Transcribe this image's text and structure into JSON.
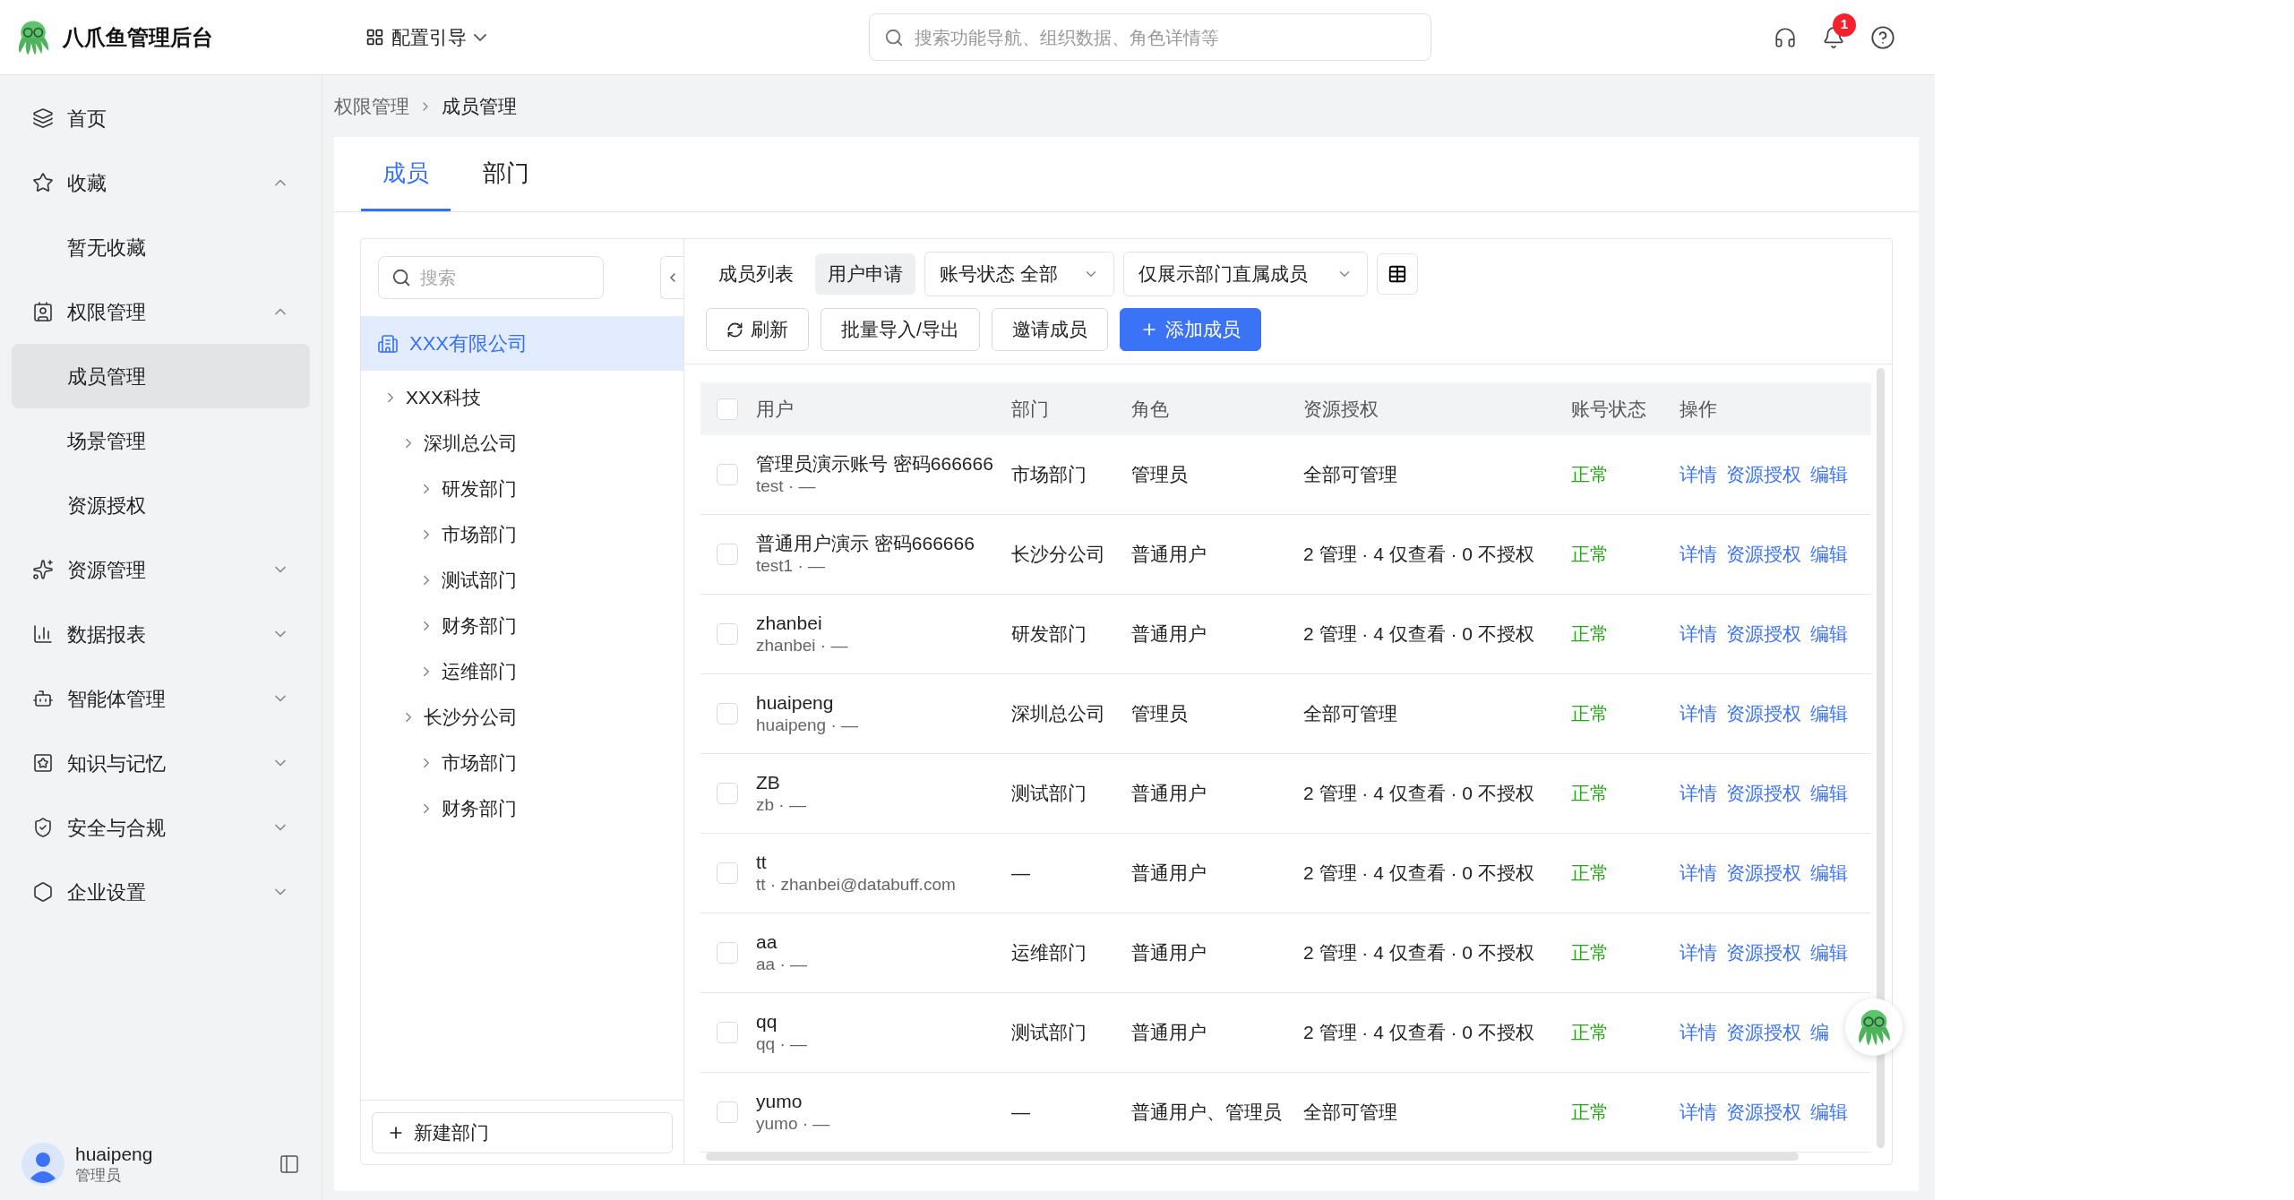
{
  "app": {
    "title": "八爪鱼管理后台"
  },
  "header": {
    "guide": "配置引导",
    "search_placeholder": "搜索功能导航、组织数据、角色详情等",
    "notification_count": "1"
  },
  "sidebar": {
    "items": [
      {
        "label": "首页",
        "kind": "link",
        "selected": false
      },
      {
        "label": "收藏",
        "kind": "group",
        "selected": false,
        "expanded": true,
        "children": [
          {
            "label": "暂无收藏",
            "selected": false
          }
        ]
      },
      {
        "label": "权限管理",
        "kind": "group",
        "selected": false,
        "expanded": true,
        "children": [
          {
            "label": "成员管理",
            "selected": true
          },
          {
            "label": "场景管理",
            "selected": false
          },
          {
            "label": "资源授权",
            "selected": false
          }
        ]
      },
      {
        "label": "资源管理",
        "kind": "group",
        "selected": false,
        "expanded": false
      },
      {
        "label": "数据报表",
        "kind": "group",
        "selected": false,
        "expanded": false
      },
      {
        "label": "智能体管理",
        "kind": "group",
        "selected": false,
        "expanded": false
      },
      {
        "label": "知识与记忆",
        "kind": "group",
        "selected": false,
        "expanded": false
      },
      {
        "label": "安全与合规",
        "kind": "group",
        "selected": false,
        "expanded": false
      },
      {
        "label": "企业设置",
        "kind": "group",
        "selected": false,
        "expanded": false
      }
    ],
    "user": {
      "name": "huaipeng",
      "role": "管理员"
    }
  },
  "breadcrumb": [
    "权限管理",
    "成员管理"
  ],
  "tabs": [
    {
      "label": "成员",
      "selected": true
    },
    {
      "label": "部门",
      "selected": false
    }
  ],
  "tree": {
    "search_placeholder": "搜索",
    "root": {
      "label": "XXX有限公司",
      "selected": true
    },
    "children": [
      {
        "label": "XXX科技",
        "children": [
          {
            "label": "深圳总公司",
            "children": [
              {
                "label": "研发部门"
              },
              {
                "label": "市场部门"
              },
              {
                "label": "测试部门"
              },
              {
                "label": "财务部门"
              },
              {
                "label": "运维部门"
              }
            ]
          },
          {
            "label": "长沙分公司",
            "children": [
              {
                "label": "市场部门"
              },
              {
                "label": "财务部门"
              }
            ]
          }
        ]
      }
    ],
    "new_button": "新建部门"
  },
  "toolbar": {
    "views": [
      {
        "label": "成员列表",
        "selected": false
      },
      {
        "label": "用户申请",
        "selected": true
      }
    ],
    "filters": [
      "账号状态 全部",
      "仅展示部门直属成员"
    ],
    "buttons": [
      {
        "label": "刷新",
        "kind": "refresh"
      },
      {
        "label": "批量导入/导出",
        "kind": "plain"
      },
      {
        "label": "邀请成员",
        "kind": "plain"
      },
      {
        "label": "添加成员",
        "kind": "primary"
      }
    ]
  },
  "table": {
    "columns": [
      "用户",
      "部门",
      "角色",
      "资源授权",
      "账号状态",
      "操作"
    ],
    "header_checked": false,
    "rows": [
      {
        "checked": false,
        "name": "管理员演示账号 密码666666",
        "sub": "test · —",
        "dept": "市场部门",
        "role": "管理员",
        "resources": "全部可管理",
        "status": "正常",
        "actions": [
          "详情",
          "资源授权",
          "编辑"
        ]
      },
      {
        "checked": false,
        "name": "普通用户演示 密码666666",
        "sub": "test1 · —",
        "dept": "长沙分公司",
        "role": "普通用户",
        "resources": "2 管理 · 4 仅查看 · 0 不授权",
        "status": "正常",
        "actions": [
          "详情",
          "资源授权",
          "编辑"
        ]
      },
      {
        "checked": false,
        "name": "zhanbei",
        "sub": "zhanbei · —",
        "dept": "研发部门",
        "role": "普通用户",
        "resources": "2 管理 · 4 仅查看 · 0 不授权",
        "status": "正常",
        "actions": [
          "详情",
          "资源授权",
          "编辑"
        ]
      },
      {
        "checked": false,
        "name": "huaipeng",
        "sub": "huaipeng · —",
        "dept": "深圳总公司",
        "role": "管理员",
        "resources": "全部可管理",
        "status": "正常",
        "actions": [
          "详情",
          "资源授权",
          "编辑"
        ]
      },
      {
        "checked": false,
        "name": "ZB",
        "sub": "zb · —",
        "dept": "测试部门",
        "role": "普通用户",
        "resources": "2 管理 · 4 仅查看 · 0 不授权",
        "status": "正常",
        "actions": [
          "详情",
          "资源授权",
          "编辑"
        ]
      },
      {
        "checked": false,
        "name": "tt",
        "sub": "tt · zhanbei@databuff.com",
        "dept": "—",
        "role": "普通用户",
        "resources": "2 管理 · 4 仅查看 · 0 不授权",
        "status": "正常",
        "actions": [
          "详情",
          "资源授权",
          "编辑"
        ]
      },
      {
        "checked": false,
        "name": "aa",
        "sub": "aa · —",
        "dept": "运维部门",
        "role": "普通用户",
        "resources": "2 管理 · 4 仅查看 · 0 不授权",
        "status": "正常",
        "actions": [
          "详情",
          "资源授权",
          "编辑"
        ]
      },
      {
        "checked": false,
        "name": "qq",
        "sub": "qq · —",
        "dept": "测试部门",
        "role": "普通用户",
        "resources": "2 管理 · 4 仅查看 · 0 不授权",
        "status": "正常",
        "actions": [
          "详情",
          "资源授权",
          "编"
        ]
      },
      {
        "checked": false,
        "name": "yumo",
        "sub": "yumo · —",
        "dept": "—",
        "role": "普通用户、管理员",
        "resources": "全部可管理",
        "status": "正常",
        "actions": [
          "详情",
          "资源授权",
          "编辑"
        ]
      }
    ]
  }
}
